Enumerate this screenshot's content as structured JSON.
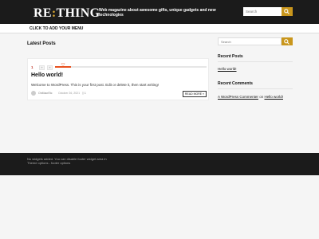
{
  "header": {
    "logo_left": "RE",
    "logo_colon": ":",
    "logo_right": "THING",
    "tagline": "Web magazine about awesome gifts, unique gadgets and new technologies",
    "search_placeholder": "Search"
  },
  "menu": {
    "toggle_label": "CLICK TO ADD YOUR MENU"
  },
  "main": {
    "section_title": "Latest Posts",
    "post": {
      "share_count": "1",
      "share_buttons": [
        "+",
        "+"
      ],
      "title": "Hello world!",
      "excerpt": "Welcome to WordPress. This is your first post. Edit or delete it, then start writing!",
      "author": "OnMacrEtc",
      "date": "October 26, 2021",
      "comments": "1",
      "read_more": "READ MORE »"
    }
  },
  "sidebar": {
    "search_placeholder": "Search",
    "recent_posts_title": "Recent Posts",
    "recent_posts": [
      "Hello world!"
    ],
    "recent_comments_title": "Recent Comments",
    "comment_author": "A WordPress Commenter",
    "comment_on": "on",
    "comment_post": "Hello world!"
  },
  "footer": {
    "text": "No widgets added. You can disable footer widget area in Theme options - footer options"
  },
  "colors": {
    "accent": "#c9961c",
    "header_bg": "#1b1b1b",
    "share_accent": "#e8511f"
  },
  "icons": {
    "search": "search-icon",
    "heart": "heart-icon",
    "comment": "comment-icon",
    "avatar": "avatar"
  }
}
